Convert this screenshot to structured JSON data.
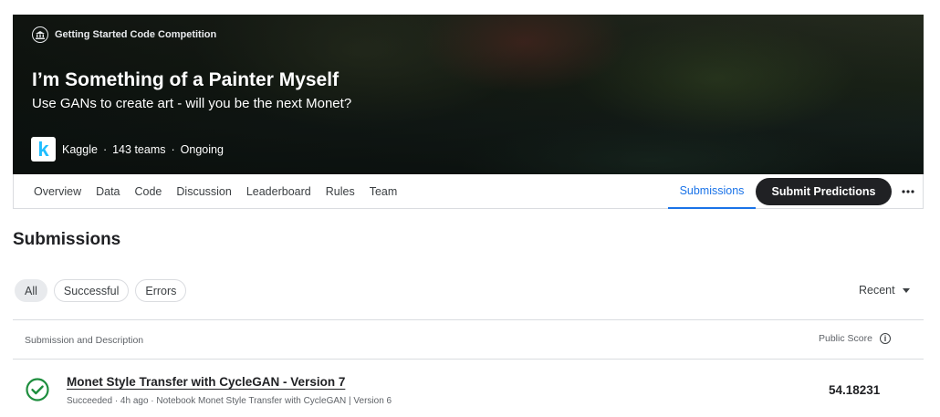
{
  "competition": {
    "type_label": "Getting Started Code Competition",
    "title": "I’m Something of a Painter Myself",
    "subtitle": "Use GANs to create art - will you be the next Monet?",
    "host": "Kaggle",
    "teams": "143 teams",
    "status": "Ongoing",
    "separator": "·"
  },
  "nav": {
    "tabs": [
      "Overview",
      "Data",
      "Code",
      "Discussion",
      "Leaderboard",
      "Rules",
      "Team"
    ],
    "active_tab": "Submissions",
    "submit_label": "Submit Predictions",
    "more_label": "•••"
  },
  "page_title": "Submissions",
  "filters": {
    "chips": [
      "All",
      "Successful",
      "Errors"
    ],
    "selected": "All",
    "sort_label": "Recent"
  },
  "table": {
    "col_left": "Submission and Description",
    "col_right": "Public Score",
    "rows": [
      {
        "title": "Monet Style Transfer with CycleGAN - Version 7",
        "description": "Succeeded · 4h ago · Notebook Monet Style Transfer with CycleGAN | Version 6",
        "score": "54.18231",
        "status_icon": "check-circle-icon"
      }
    ]
  },
  "colors": {
    "accent": "#1a73e8",
    "success": "#1e8e3e",
    "kaggle_blue": "#20beff",
    "dark_button": "#202124"
  }
}
